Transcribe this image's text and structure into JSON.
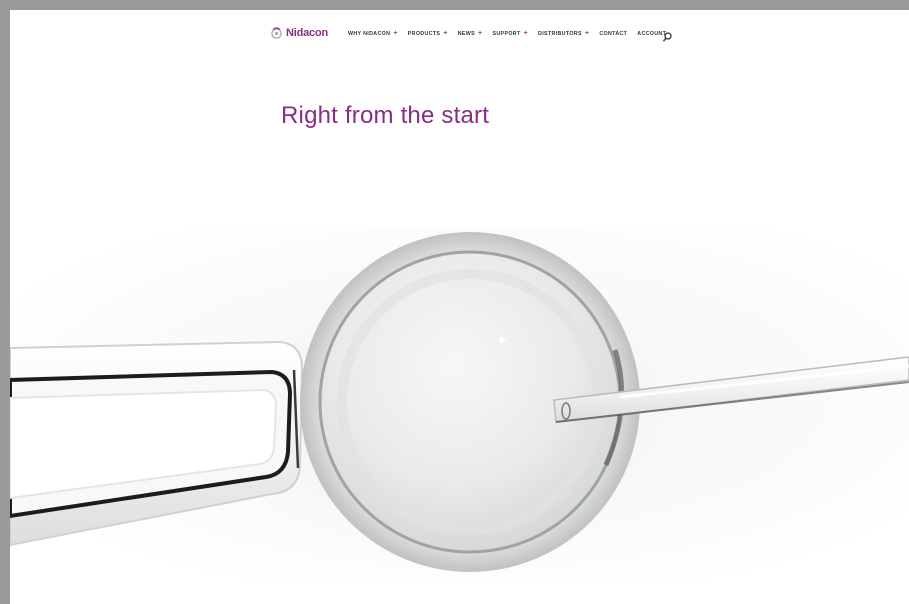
{
  "brand": {
    "name": "Nidacon",
    "color": "#8b2c86"
  },
  "nav": {
    "items": [
      {
        "label": "WHY NIDACON",
        "has_submenu": true
      },
      {
        "label": "PRODUCTS",
        "has_submenu": true
      },
      {
        "label": "NEWS",
        "has_submenu": true
      },
      {
        "label": "SUPPORT",
        "has_submenu": true
      },
      {
        "label": "DISTRIBUTORS",
        "has_submenu": true
      },
      {
        "label": "CONTACT",
        "has_submenu": false
      },
      {
        "label": "ACCOUNT",
        "has_submenu": false
      }
    ],
    "submenu_marker": "+",
    "search_icon": "search-icon"
  },
  "hero": {
    "title": "Right from the start",
    "image_icon": "oocyte-micromanipulation-image"
  }
}
